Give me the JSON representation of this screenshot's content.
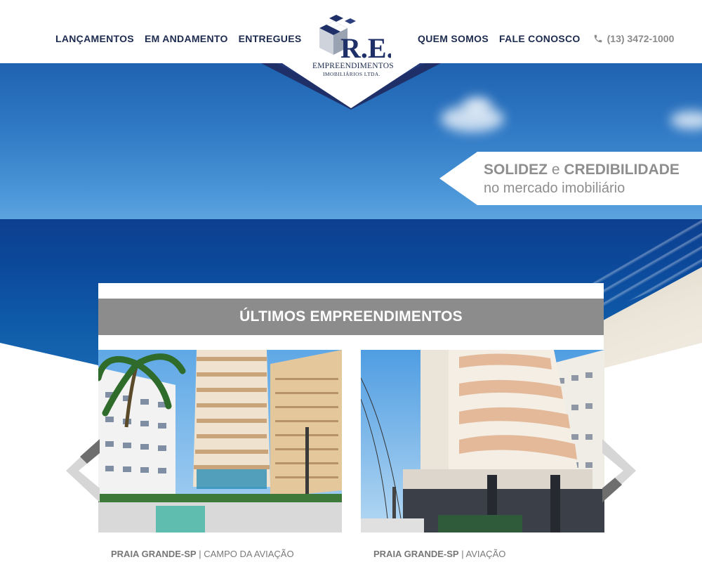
{
  "brand": {
    "logo_letters": "R.E.",
    "logo_line1": "EMPREENDIMENTOS",
    "logo_line2": "IMOBILIÁRIOS LTDA.",
    "colors": {
      "navy": "#1d2b4f",
      "grey": "#8c8c8c"
    }
  },
  "nav": {
    "left": [
      {
        "label": "LANÇAMENTOS"
      },
      {
        "label": "EM ANDAMENTO"
      },
      {
        "label": "ENTREGUES"
      }
    ],
    "right": [
      {
        "label": "QUEM SOMOS"
      },
      {
        "label": "FALE CONOSCO"
      }
    ],
    "phone": {
      "icon": "phone-icon",
      "number": "(13) 3472-1000"
    }
  },
  "hero": {
    "tagline_bold1": "SOLIDEZ",
    "tagline_joiner": "e",
    "tagline_bold2": "CREDIBILIDADE",
    "tagline_line2": "no mercado imobiliário"
  },
  "section": {
    "title": "ÚLTIMOS EMPREENDIMENTOS",
    "items": [
      {
        "city": "PRAIA GRANDE-SP",
        "separator": "|",
        "neighborhood": "CAMPO DA AVIAÇÃO"
      },
      {
        "city": "PRAIA GRANDE-SP",
        "separator": "|",
        "neighborhood": "AVIAÇÃO"
      }
    ]
  },
  "carousel": {
    "prev_icon": "chevron-left-icon",
    "next_icon": "chevron-right-icon"
  }
}
